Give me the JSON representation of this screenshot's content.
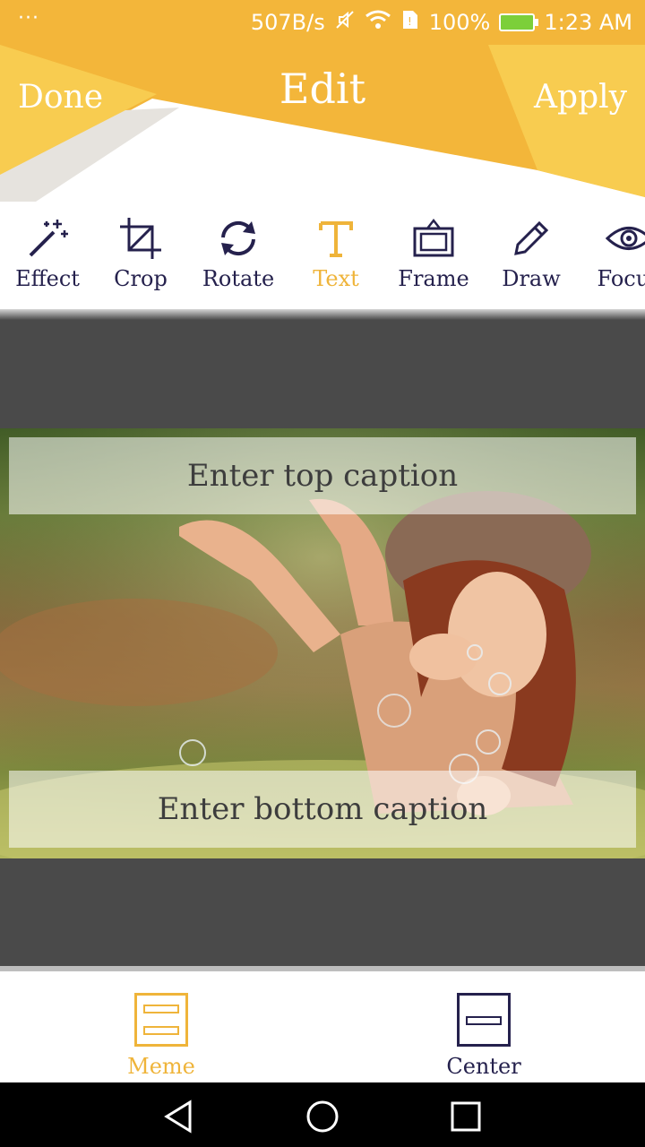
{
  "status_bar": {
    "dots": "···",
    "speed": "507B/s",
    "battery": "100%",
    "time": "1:23 AM"
  },
  "header": {
    "title": "Edit",
    "done_label": "Done",
    "apply_label": "Apply"
  },
  "toolbar": {
    "items": [
      {
        "label": "Effect",
        "icon": "magic-wand-icon"
      },
      {
        "label": "Crop",
        "icon": "crop-icon"
      },
      {
        "label": "Rotate",
        "icon": "rotate-icon"
      },
      {
        "label": "Text",
        "icon": "text-icon"
      },
      {
        "label": "Frame",
        "icon": "frame-icon"
      },
      {
        "label": "Draw",
        "icon": "pencil-icon"
      },
      {
        "label": "Focus",
        "icon": "eye-icon"
      }
    ],
    "active": "Text"
  },
  "captions": {
    "top_placeholder": "Enter top caption",
    "bottom_placeholder": "Enter bottom caption"
  },
  "options": {
    "meme_label": "Meme",
    "center_label": "Center",
    "selected": "Meme"
  },
  "colors": {
    "accent": "#efb43a",
    "header_yellow": "#f3b63a",
    "header_light": "#f8cc50",
    "icon_dark": "#25214d",
    "canvas_bg": "#4a4a4a"
  }
}
